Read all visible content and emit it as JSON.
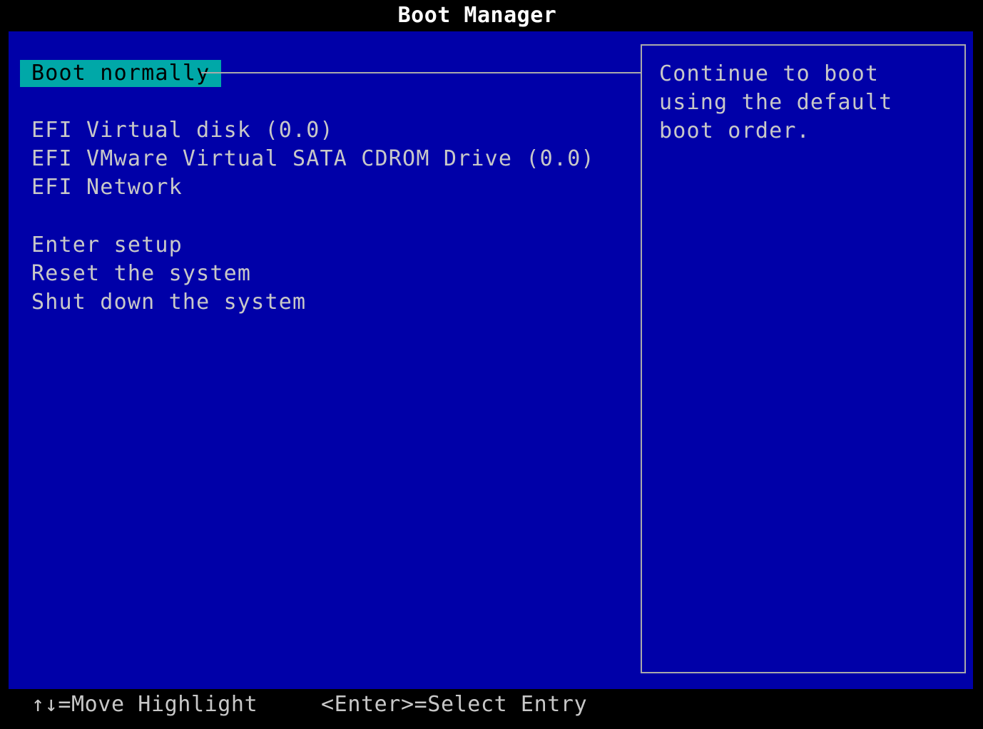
{
  "window": {
    "title": "Boot Manager"
  },
  "menu": {
    "selected_index": 0,
    "items": [
      {
        "label": "Boot normally"
      },
      {
        "label": "EFI Virtual disk (0.0)"
      },
      {
        "label": "EFI VMware Virtual SATA CDROM Drive (0.0)"
      },
      {
        "label": "EFI Network"
      },
      {
        "label": "Enter setup"
      },
      {
        "label": "Reset the system"
      },
      {
        "label": "Shut down the system"
      }
    ]
  },
  "help": {
    "text": "Continue to boot using the default boot order."
  },
  "footer": {
    "move_hint": "↑↓=Move Highlight",
    "select_hint": "<Enter>=Select Entry"
  },
  "colors": {
    "background": "#0000a8",
    "highlight": "#00a8a8",
    "text": "#c8c8c8",
    "bars": "#000000"
  }
}
